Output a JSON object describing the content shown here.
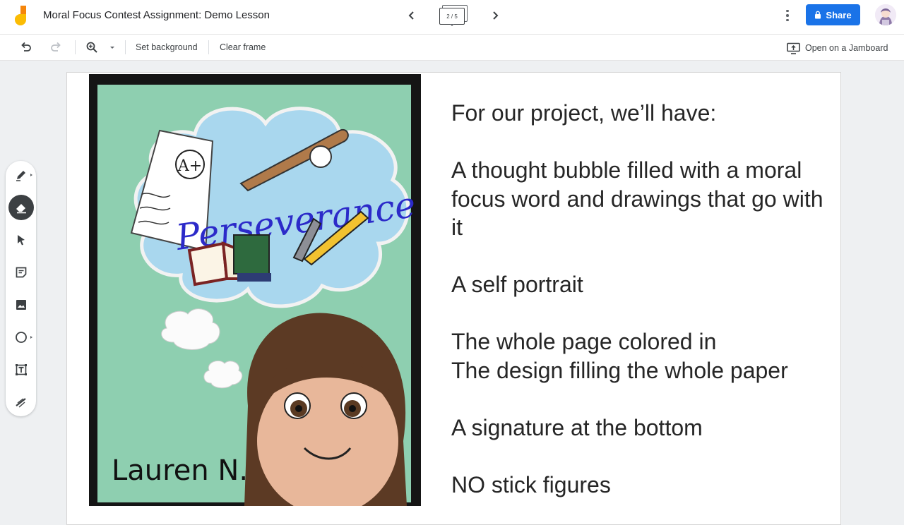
{
  "app": {
    "title": "Moral Focus Contest Assignment: Demo Lesson",
    "frame_indicator": "2 / 5",
    "share_label": "Share",
    "accent_color": "#1a73e8"
  },
  "toolbar": {
    "set_background_label": "Set background",
    "clear_frame_label": "Clear frame",
    "open_on_jamboard_label": "Open on a Jamboard"
  },
  "tools": [
    {
      "name": "pen-tool",
      "icon": "pen-icon"
    },
    {
      "name": "eraser-tool",
      "icon": "eraser-icon",
      "active": true
    },
    {
      "name": "select-tool",
      "icon": "cursor-arrow-icon"
    },
    {
      "name": "sticky-note-tool",
      "icon": "sticky-note-icon"
    },
    {
      "name": "add-image-tool",
      "icon": "image-icon"
    },
    {
      "name": "shape-tool",
      "icon": "circle-icon"
    },
    {
      "name": "text-box-tool",
      "icon": "text-box-icon"
    },
    {
      "name": "laser-tool",
      "icon": "laser-icon"
    }
  ],
  "artwork": {
    "word": "Perseverance",
    "signature": "Lauren N.",
    "grade_badge": "A+"
  },
  "slide": {
    "line1": "For our project, we’ll have:",
    "line2": "A thought bubble filled with a moral focus word and drawings that go with it",
    "line3": "A self portrait",
    "line4": "The whole page colored in",
    "line5": "The design filling the whole paper",
    "line6": "A signature at the bottom",
    "line7": "NO stick figures"
  }
}
